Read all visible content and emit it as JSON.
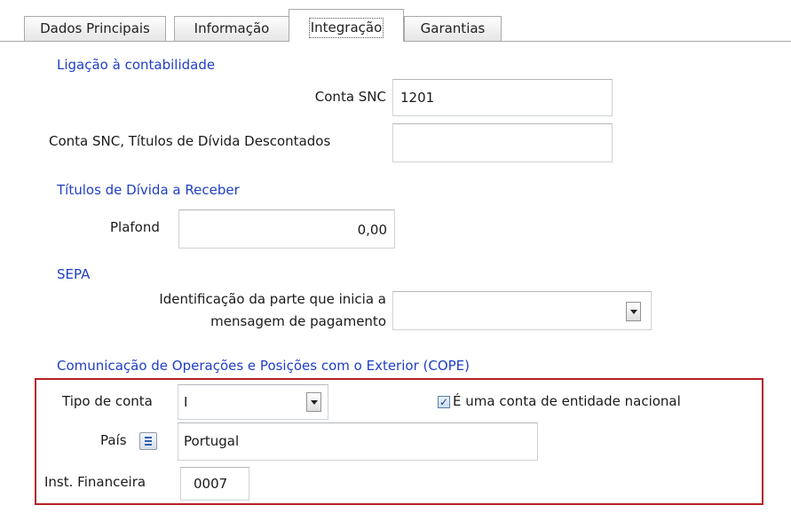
{
  "tabs": [
    {
      "label": "Dados Principais"
    },
    {
      "label": "Informação"
    },
    {
      "label": "Integração"
    },
    {
      "label": "Garantias"
    }
  ],
  "contabilidade": {
    "title": "Ligação à contabilidade",
    "conta_snc_label": "Conta SNC",
    "conta_snc_value": "1201",
    "conta_titulos_label": "Conta SNC, Títulos de Dívida Descontados",
    "conta_titulos_value": ""
  },
  "titulos": {
    "title": "Títulos de Dívida a Receber",
    "plafond_label": "Plafond",
    "plafond_value": "0,00"
  },
  "sepa": {
    "title": "SEPA",
    "ident_label_line1": "Identificação da parte que inicia a",
    "ident_label_line2": "mensagem de pagamento",
    "ident_value": ""
  },
  "cope": {
    "title": "Comunicação de Operações e Posições com o Exterior (COPE)",
    "tipo_conta_label": "Tipo de conta",
    "tipo_conta_value": "I",
    "entidade_nacional_label": "É uma conta de entidade nacional",
    "entidade_nacional_checked": true,
    "pais_label": "País",
    "pais_value": "Portugal",
    "inst_label": "Inst. Financeira",
    "inst_value": "0007"
  },
  "colors": {
    "section_title": "#1f3fc6",
    "highlight_box": "#b52025"
  }
}
